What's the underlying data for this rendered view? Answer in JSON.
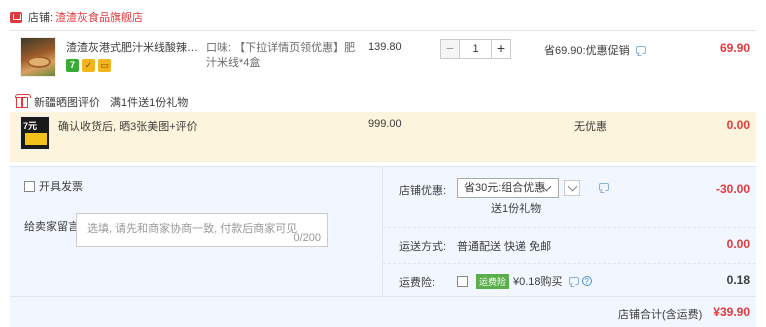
{
  "store": {
    "label": "店铺:",
    "name": "渣渣灰食品旗舰店",
    "icon": "shop-icon"
  },
  "item": {
    "name": "渣渣灰港式肥汁米线酸辣米粉酸...",
    "badges": [
      {
        "icon": "seven-day-return-icon",
        "text": "7"
      },
      {
        "icon": "guarantee-icon",
        "text": ""
      },
      {
        "icon": "credit-card-icon",
        "text": ""
      }
    ],
    "props": "口味: 【下拉详情页领优惠】肥汁米线*4盒",
    "price": "139.80",
    "quantity": "1",
    "promo": "省69.90:优惠促销",
    "subtotal": "69.90",
    "colors": {
      "accent": "#e4393c"
    }
  },
  "gift_section": {
    "tag": "新疆晒图评价",
    "description": "满1件送1份礼物",
    "item": {
      "name": "确认收货后, 晒3张美图+评价",
      "price": "999.00",
      "promo": "无优惠",
      "subtotal": "0.00"
    }
  },
  "order": {
    "invoice_label": "开具发票",
    "message_label": "给卖家留言:",
    "message_placeholder": "选填, 请先和商家协商一致, 付款后商家可见",
    "message_count": "0/200",
    "store_discount": {
      "label": "店铺优惠:",
      "selected": "省30元:组合优惠",
      "note": "送1份礼物",
      "value": "-30.00"
    },
    "shipping": {
      "label": "运送方式:",
      "method": "普通配送 快递 免邮",
      "value": "0.00"
    },
    "insurance": {
      "label": "运费险:",
      "tag": "运费险",
      "text": "¥0.18购买",
      "value": "0.18"
    },
    "total": {
      "label": "店铺合计(含运费)",
      "value": "¥39.90"
    }
  }
}
